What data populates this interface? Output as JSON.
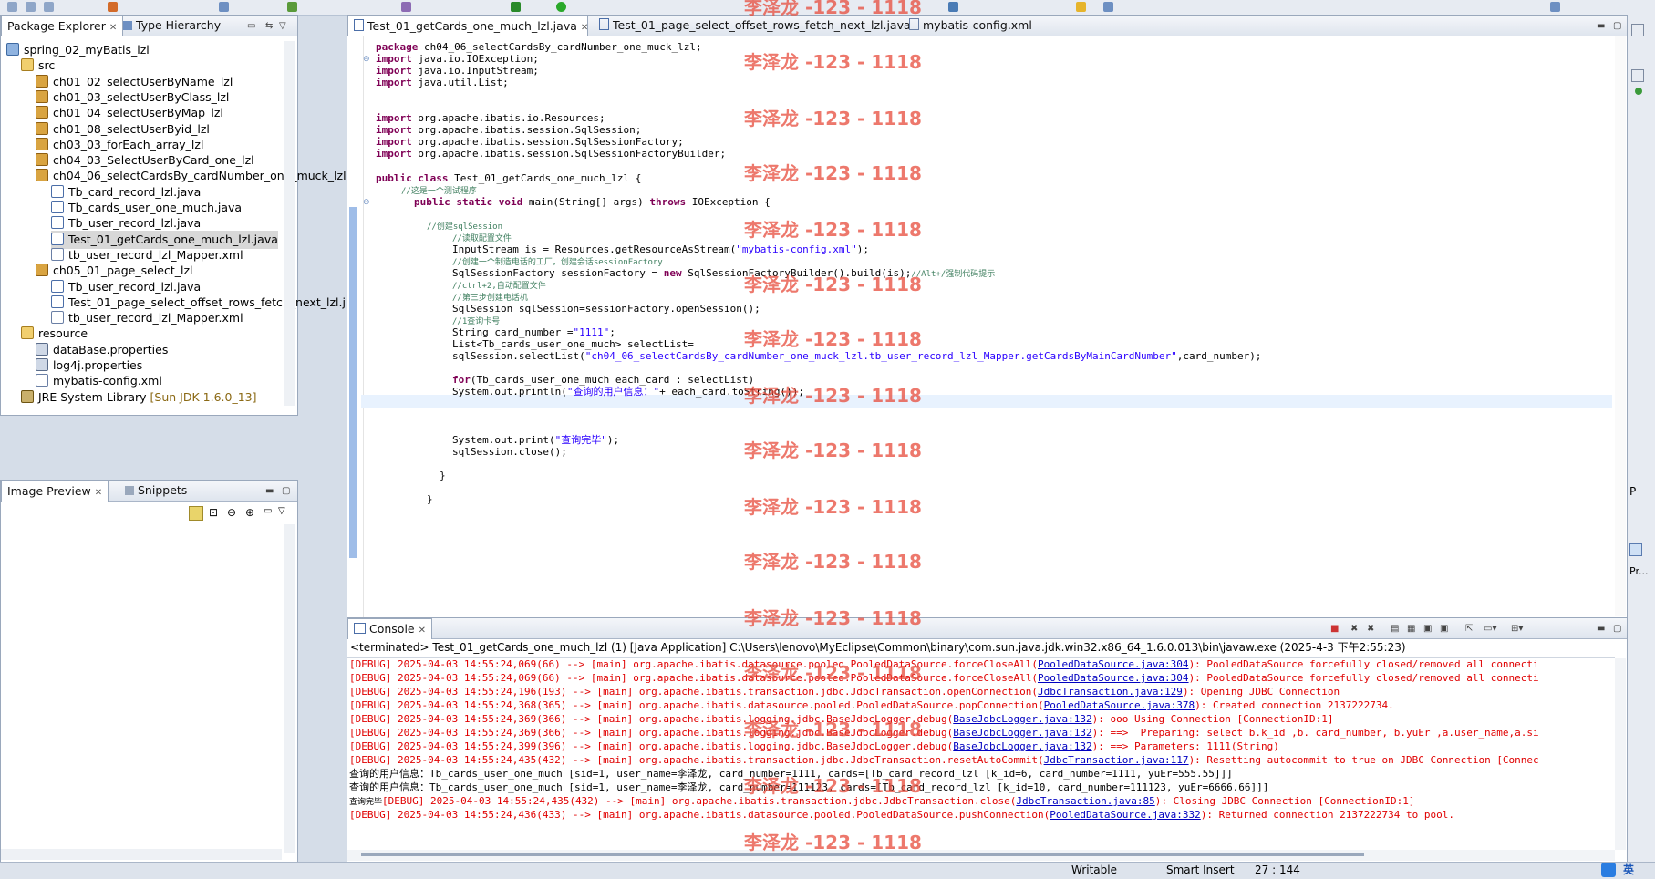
{
  "colors": {
    "accent": "#2a5fab",
    "keyword": "#7f0055",
    "comment": "#3f7f5f",
    "string": "#2a00ff",
    "error": "#e00000",
    "watermark": "#e74c3c"
  },
  "package_explorer": {
    "tab_label": "Package Explorer",
    "tab2_label": "Type Hierarchy",
    "items": [
      {
        "label": "spring_02_myBatis_lzl",
        "icon": "project-icon"
      },
      {
        "label": "src",
        "icon": "src-folder-icon"
      },
      {
        "label": "ch01_02_selectUserByName_lzl",
        "icon": "package-icon"
      },
      {
        "label": "ch01_03_selectUserByClass_lzl",
        "icon": "package-icon"
      },
      {
        "label": "ch01_04_selectUserByMap_lzl",
        "icon": "package-icon"
      },
      {
        "label": "ch01_08_selectUserByid_lzl",
        "icon": "package-icon"
      },
      {
        "label": "ch03_03_forEach_array_lzl",
        "icon": "package-icon"
      },
      {
        "label": "ch04_03_SelectUserByCard_one_lzl",
        "icon": "package-icon"
      },
      {
        "label": "ch04_06_selectCardsBy_cardNumber_one_muck_lzl",
        "icon": "package-icon"
      },
      {
        "label": "Tb_card_record_lzl.java",
        "icon": "java-file-icon"
      },
      {
        "label": "Tb_cards_user_one_much.java",
        "icon": "java-file-icon"
      },
      {
        "label": "Tb_user_record_lzl.java",
        "icon": "java-file-icon"
      },
      {
        "label": "Test_01_getCards_one_much_lzl.java",
        "icon": "java-file-icon"
      },
      {
        "label": "tb_user_record_lzl_Mapper.xml",
        "icon": "xml-file-icon"
      },
      {
        "label": "ch05_01_page_select_lzl",
        "icon": "package-icon"
      },
      {
        "label": "Tb_user_record_lzl.java",
        "icon": "java-file-icon"
      },
      {
        "label": "Test_01_page_select_offset_rows_fetch_next_lzl.j",
        "icon": "java-file-icon"
      },
      {
        "label": "tb_user_record_lzl_Mapper.xml",
        "icon": "xml-file-icon"
      },
      {
        "label": "resource",
        "icon": "folder-icon"
      },
      {
        "label": "dataBase.properties",
        "icon": "properties-file-icon"
      },
      {
        "label": "log4j.properties",
        "icon": "properties-file-icon"
      },
      {
        "label": "mybatis-config.xml",
        "icon": "xml-file-icon"
      },
      {
        "label": "JRE System Library",
        "icon": "library-icon",
        "suffix": "[Sun JDK 1.6.0_13]"
      }
    ]
  },
  "image_preview": {
    "tab_label": "Image Preview",
    "tab2_label": "Snippets"
  },
  "editor": {
    "tabs": [
      {
        "label": "Test_01_getCards_one_much_lzl.java"
      },
      {
        "label": "Test_01_page_select_offset_rows_fetch_next_lzl.java"
      },
      {
        "label": "mybatis-config.xml"
      }
    ],
    "code": [
      {
        "k": "package",
        "t": " ch04_06_selectCardsBy_cardNumber_one_muck_lzl;"
      },
      {
        "k": "import",
        "t": " java.io.IOException;"
      },
      {
        "k": "import",
        "t": " java.io.InputStream;"
      },
      {
        "k": "import",
        "t": " java.util.List;"
      },
      {
        "k": "import",
        "t": " org.apache.ibatis.io.Resources;"
      },
      {
        "k": "import",
        "t": " org.apache.ibatis.session.SqlSession;"
      },
      {
        "k": "import",
        "t": " org.apache.ibatis.session.SqlSessionFactory;"
      },
      {
        "k": "import",
        "t": " org.apache.ibatis.session.SqlSessionFactoryBuilder;"
      },
      {
        "k": "public class",
        "t": " Test_01_getCards_one_much_lzl {"
      },
      {
        "c": "//这是一个测试程序"
      },
      {
        "t": "public static void main(String[] args) throws IOException {"
      },
      {
        "c": "//创建sqlSession"
      },
      {
        "c": "//读取配置文件"
      },
      {
        "t": "InputStream is = Resources.getResourceAsStream(\"mybatis-config.xml\");"
      },
      {
        "c": "//创建一个制造电话的工厂，创建会话sessionFactory"
      },
      {
        "t": "SqlSessionFactory sessionFactory = new SqlSessionFactoryBuilder().build(is);//Alt+/强制代码提示"
      },
      {
        "c": "//ctrl+2,自动配置文件"
      },
      {
        "c": "//第三步创建电话机"
      },
      {
        "t": "SqlSession sqlSession=sessionFactory.openSession();"
      },
      {
        "c": "//1查询卡号"
      },
      {
        "t": "String card_number =\"1111\";"
      },
      {
        "t": "List<Tb_cards_user_one_much> selectList="
      },
      {
        "t": "sqlSession.selectList(\"ch04_06_selectCardsBy_cardNumber_one_muck_lzl.tb_user_record_lzl_Mapper.getCardsByMainCardNumber\",card_number);"
      },
      {
        "t": "for(Tb_cards_user_one_much each_card : selectList)"
      },
      {
        "t": "System.out.println(\"查询的用户信息：\"+ each_card.toString());"
      },
      {
        "t": "System.out.print(\"查询完毕\");"
      },
      {
        "t": "sqlSession.close();"
      },
      {
        "t": "}"
      },
      {
        "t": "}"
      }
    ]
  },
  "watermark": "李泽龙 -123 - 1118",
  "console": {
    "tab_label": "Console",
    "header": "<terminated> Test_01_getCards_one_much_lzl (1) [Java Application] C:\\Users\\lenovo\\MyEclipse\\Common\\binary\\com.sun.java.jdk.win32.x86_64_1.6.0.013\\bin\\javaw.exe (2025-4-3 下午2:55:23)",
    "lines": [
      {
        "c": "red",
        "t": "[DEBUG] 2025-04-03 14:55:24,069(66) --> [main] org.apache.ibatis.datasource.pooled.PooledDataSource.forceCloseAll(",
        "l": "PooledDataSource.java:304",
        "e": "): PooledDataSource forcefully closed/removed all connecti"
      },
      {
        "c": "red",
        "t": "[DEBUG] 2025-04-03 14:55:24,069(66) --> [main] org.apache.ibatis.datasource.pooled.PooledDataSource.forceCloseAll(",
        "l": "PooledDataSource.java:304",
        "e": "): PooledDataSource forcefully closed/removed all connecti"
      },
      {
        "c": "red",
        "t": "[DEBUG] 2025-04-03 14:55:24,196(193) --> [main] org.apache.ibatis.transaction.jdbc.JdbcTransaction.openConnection(",
        "l": "JdbcTransaction.java:129",
        "e": "): Opening JDBC Connection"
      },
      {
        "c": "red",
        "t": "[DEBUG] 2025-04-03 14:55:24,368(365) --> [main] org.apache.ibatis.datasource.pooled.PooledDataSource.popConnection(",
        "l": "PooledDataSource.java:378",
        "e": "): Created connection 2137222734."
      },
      {
        "c": "red",
        "t": "[DEBUG] 2025-04-03 14:55:24,369(366) --> [main] org.apache.ibatis.logging.jdbc.BaseJdbcLogger.debug(",
        "l": "BaseJdbcLogger.java:132",
        "e": "): ooo Using Connection [ConnectionID:1]"
      },
      {
        "c": "red",
        "t": "[DEBUG] 2025-04-03 14:55:24,369(366) --> [main] org.apache.ibatis.logging.jdbc.BaseJdbcLogger.debug(",
        "l": "BaseJdbcLogger.java:132",
        "e": "): ==>  Preparing: select b.k_id ,b. card_number, b.yuEr ,a.user_name,a.si"
      },
      {
        "c": "red",
        "t": "[DEBUG] 2025-04-03 14:55:24,399(396) --> [main] org.apache.ibatis.logging.jdbc.BaseJdbcLogger.debug(",
        "l": "BaseJdbcLogger.java:132",
        "e": "): ==> Parameters: 1111(String)"
      },
      {
        "c": "red",
        "t": "[DEBUG] 2025-04-03 14:55:24,435(432) --> [main] org.apache.ibatis.transaction.jdbc.JdbcTransaction.resetAutoCommit(",
        "l": "JdbcTransaction.java:117",
        "e": "): Resetting autocommit to true on JDBC Connection [Connec"
      },
      {
        "c": "blk",
        "t": "查询的用户信息：Tb_cards_user_one_much [sid=1, user_name=李泽龙, card_number=1111, cards=[Tb_card_record_lzl [k_id=6, card_number=1111, yuEr=555.55]]]"
      },
      {
        "c": "blk",
        "t": "查询的用户信息：Tb_cards_user_one_much [sid=1, user_name=李泽龙, card_number=111123, cards=[Tb_card_record_lzl [k_id=10, card_number=111123, yuEr=6666.66]]]"
      },
      {
        "c": "mix",
        "p": "查询完毕",
        "t": "[DEBUG] 2025-04-03 14:55:24,435(432) --> [main] org.apache.ibatis.transaction.jdbc.JdbcTransaction.close(",
        "l": "JdbcTransaction.java:85",
        "e": "): Closing JDBC Connection [ConnectionID:1]"
      },
      {
        "c": "red",
        "t": "[DEBUG] 2025-04-03 14:55:24,436(433) --> [main] org.apache.ibatis.datasource.pooled.PooledDataSource.pushConnection(",
        "l": "PooledDataSource.java:332",
        "e": "): Returned connection 2137222734 to pool."
      }
    ]
  },
  "statusbar": {
    "mode": "Writable",
    "insert": "Smart Insert",
    "position": "27 : 144",
    "ime": "英"
  },
  "right_panel": {
    "label1": "P",
    "label2": "Pr..."
  }
}
